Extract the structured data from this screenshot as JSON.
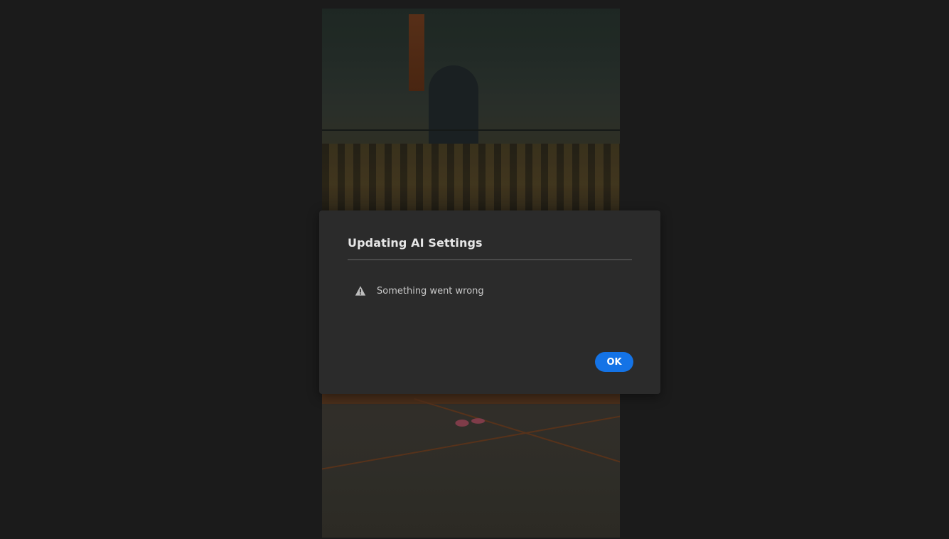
{
  "dialog": {
    "title": "Updating AI Settings",
    "message": "Something went wrong",
    "alert_icon": "alert-triangle-icon",
    "ok_label": "OK"
  },
  "colors": {
    "backdrop": "#1b1b1b",
    "dialog_bg": "#2b2b2b",
    "accent": "#1473e6"
  }
}
